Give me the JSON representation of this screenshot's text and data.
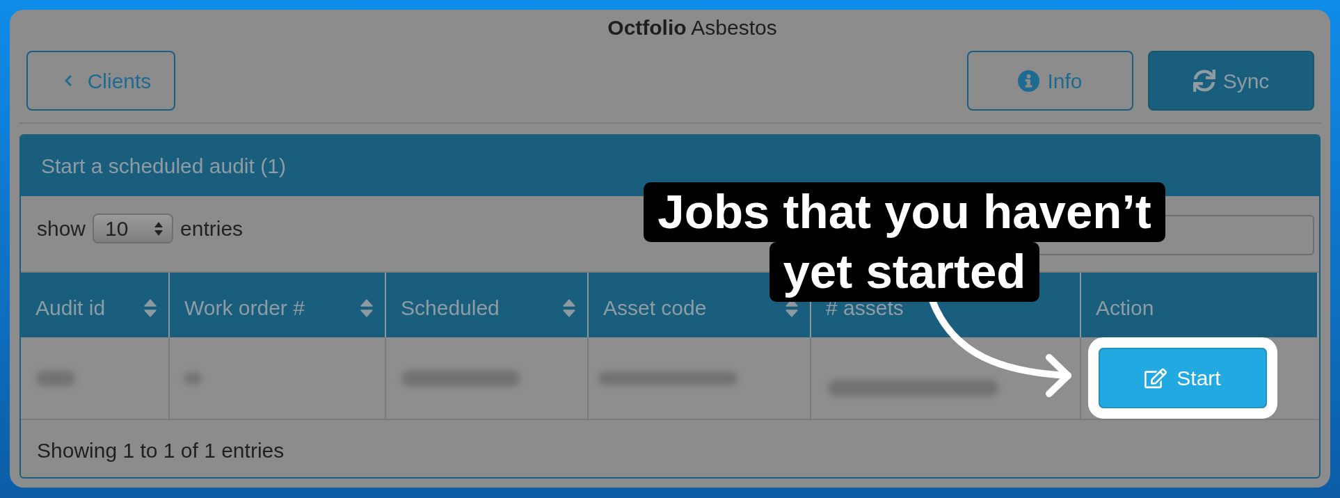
{
  "window": {
    "title": "**Octfolio** Asbestos"
  },
  "toolbar": {
    "back_button": {
      "label": "Clients"
    },
    "buttons": [
      {
        "label": "Info",
        "kind": "outline"
      },
      {
        "label": "Sync",
        "kind": "filled"
      }
    ]
  },
  "panel": {
    "title": "Start a scheduled audit (1)",
    "length_menu": {
      "before": "show",
      "value": "10",
      "after": "entries"
    },
    "table": {
      "columns": [
        {
          "label": "Audit id",
          "sortable": true
        },
        {
          "label": "Work order #",
          "sortable": true
        },
        {
          "label": "Scheduled",
          "sortable": true
        },
        {
          "label": "Asset code",
          "sortable": true
        },
        {
          "label": "# assets",
          "sortable": false
        },
        {
          "label": "Action",
          "sortable": false
        }
      ],
      "rows": [
        {
          "cells": [
            {
              "kind": "blurred"
            },
            {
              "kind": "blurred"
            },
            {
              "kind": "blurred"
            },
            {
              "kind": "blurred"
            },
            {
              "kind": "blurred"
            },
            {
              "kind": "button",
              "label": "Start",
              "highlighted": true
            }
          ]
        }
      ]
    },
    "info": "Showing 1 to 1 of 1 entries"
  },
  "annotation": {
    "lines": [
      "Jobs that you haven’t",
      "yet started"
    ]
  }
}
